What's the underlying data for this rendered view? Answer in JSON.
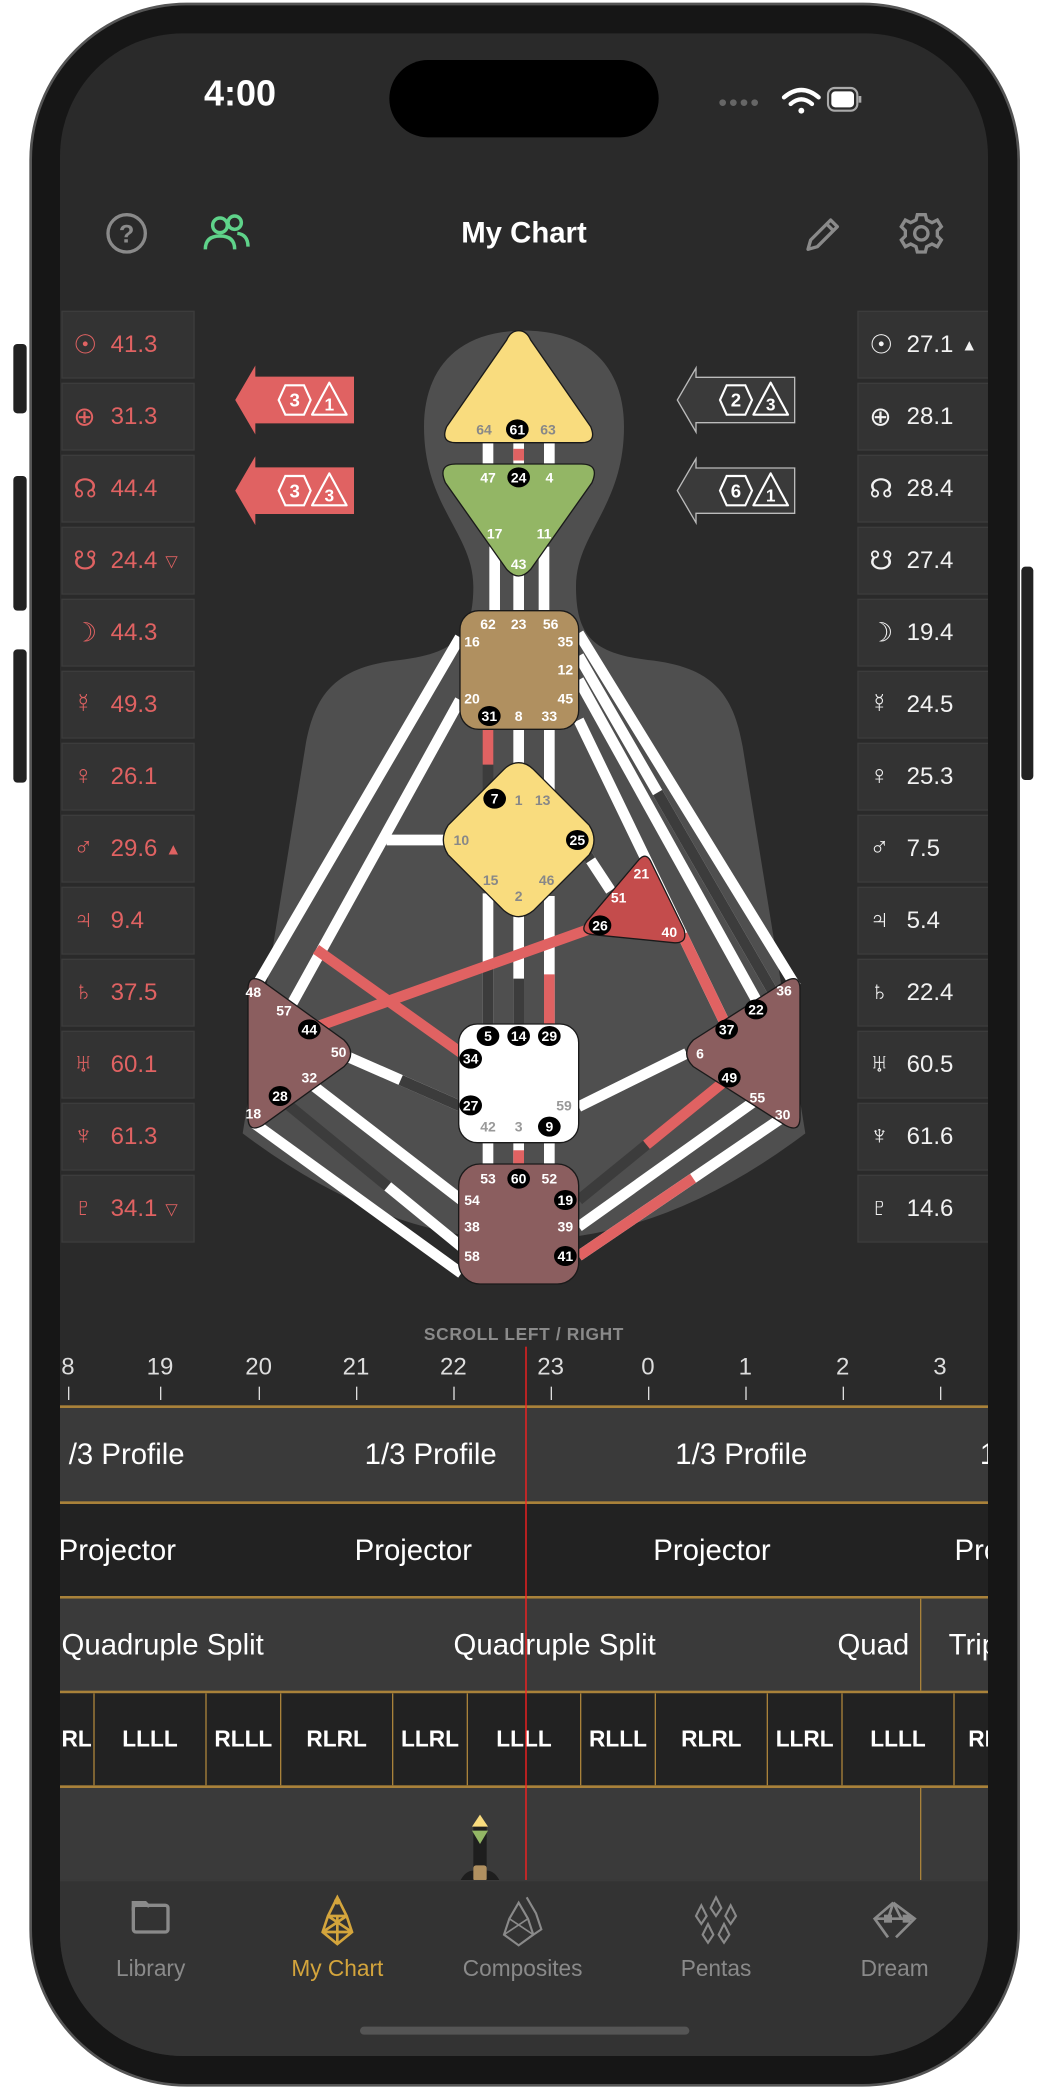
{
  "status_bar": {
    "time": "4:00"
  },
  "header": {
    "title": "My Chart",
    "help_icon": "question-circle-icon",
    "people_icon": "people-icon",
    "edit_icon": "pencil-icon",
    "settings_icon": "gear-icon",
    "people_icon_color": "#5fd38a"
  },
  "design_planets": [
    {
      "symbol": "☉",
      "value": "41.3",
      "arrow": ""
    },
    {
      "symbol": "⊕",
      "value": "31.3",
      "arrow": ""
    },
    {
      "symbol": "☊",
      "value": "44.4",
      "arrow": ""
    },
    {
      "symbol": "☋",
      "value": "24.4",
      "arrow": "▽"
    },
    {
      "symbol": "☽",
      "value": "44.3",
      "arrow": ""
    },
    {
      "symbol": "☿",
      "value": "49.3",
      "arrow": ""
    },
    {
      "symbol": "♀",
      "value": "26.1",
      "arrow": ""
    },
    {
      "symbol": "♂",
      "value": "29.6",
      "arrow": "▲"
    },
    {
      "symbol": "♃",
      "value": "9.4",
      "arrow": ""
    },
    {
      "symbol": "♄",
      "value": "37.5",
      "arrow": ""
    },
    {
      "symbol": "♅",
      "value": "60.1",
      "arrow": ""
    },
    {
      "symbol": "♆",
      "value": "61.3",
      "arrow": ""
    },
    {
      "symbol": "♇",
      "value": "34.1",
      "arrow": "▽"
    }
  ],
  "personality_planets": [
    {
      "symbol": "☉",
      "value": "27.1",
      "arrow": "▲"
    },
    {
      "symbol": "⊕",
      "value": "28.1",
      "arrow": ""
    },
    {
      "symbol": "☊",
      "value": "28.4",
      "arrow": ""
    },
    {
      "symbol": "☋",
      "value": "27.4",
      "arrow": ""
    },
    {
      "symbol": "☽",
      "value": "19.4",
      "arrow": ""
    },
    {
      "symbol": "☿",
      "value": "24.5",
      "arrow": ""
    },
    {
      "symbol": "♀",
      "value": "25.3",
      "arrow": ""
    },
    {
      "symbol": "♂",
      "value": "7.5",
      "arrow": ""
    },
    {
      "symbol": "♃",
      "value": "5.4",
      "arrow": ""
    },
    {
      "symbol": "♄",
      "value": "22.4",
      "arrow": ""
    },
    {
      "symbol": "♅",
      "value": "60.5",
      "arrow": ""
    },
    {
      "symbol": "♆",
      "value": "61.6",
      "arrow": ""
    },
    {
      "symbol": "♇",
      "value": "14.6",
      "arrow": ""
    }
  ],
  "variable_arrows": {
    "design": [
      {
        "hex": "3",
        "tri": "1"
      },
      {
        "hex": "3",
        "tri": "3"
      }
    ],
    "personality": [
      {
        "hex": "2",
        "tri": "3"
      },
      {
        "hex": "6",
        "tri": "1"
      }
    ]
  },
  "colors": {
    "design": "#e06262",
    "personality": "#ffffff",
    "head": "#f9dc7e",
    "ajna": "#93b665",
    "throat": "#b09060",
    "g": "#f9dc7e",
    "ego": "#c44c4c",
    "sacral": "#ffffff",
    "root": "#8b5e5f",
    "spleen": "#8b5e5f",
    "solar_plexus": "#8b5e5f",
    "accent": "#d4a53c",
    "timeline_border": "#a9823a",
    "cursor": "#ff2020"
  },
  "centers": {
    "head": [
      {
        "g": "64",
        "a": false
      },
      {
        "g": "61",
        "a": true
      },
      {
        "g": "63",
        "a": false
      }
    ],
    "ajna": [
      {
        "g": "47",
        "a": false
      },
      {
        "g": "24",
        "a": true
      },
      {
        "g": "4",
        "a": false
      },
      {
        "g": "17",
        "a": false
      },
      {
        "g": "11",
        "a": false
      },
      {
        "g": "43",
        "a": false
      }
    ],
    "throat": [
      {
        "g": "62",
        "a": false
      },
      {
        "g": "23",
        "a": false
      },
      {
        "g": "56",
        "a": false
      },
      {
        "g": "16",
        "a": false
      },
      {
        "g": "35",
        "a": false
      },
      {
        "g": "12",
        "a": false
      },
      {
        "g": "20",
        "a": false
      },
      {
        "g": "45",
        "a": false
      },
      {
        "g": "31",
        "a": true
      },
      {
        "g": "8",
        "a": false
      },
      {
        "g": "33",
        "a": false
      }
    ],
    "g": [
      {
        "g": "1",
        "a": false
      },
      {
        "g": "7",
        "a": true
      },
      {
        "g": "13",
        "a": false
      },
      {
        "g": "10",
        "a": false
      },
      {
        "g": "25",
        "a": true
      },
      {
        "g": "15",
        "a": false
      },
      {
        "g": "46",
        "a": false
      },
      {
        "g": "2",
        "a": false
      }
    ],
    "ego": [
      {
        "g": "21",
        "a": false
      },
      {
        "g": "51",
        "a": false
      },
      {
        "g": "26",
        "a": true
      },
      {
        "g": "40",
        "a": false
      }
    ],
    "sacral": [
      {
        "g": "5",
        "a": true
      },
      {
        "g": "14",
        "a": true
      },
      {
        "g": "29",
        "a": true
      },
      {
        "g": "34",
        "a": true
      },
      {
        "g": "27",
        "a": true
      },
      {
        "g": "59",
        "a": false
      },
      {
        "g": "42",
        "a": false
      },
      {
        "g": "3",
        "a": false
      },
      {
        "g": "9",
        "a": true
      }
    ],
    "root": [
      {
        "g": "53",
        "a": false
      },
      {
        "g": "60",
        "a": true
      },
      {
        "g": "52",
        "a": false
      },
      {
        "g": "54",
        "a": false
      },
      {
        "g": "19",
        "a": true
      },
      {
        "g": "38",
        "a": false
      },
      {
        "g": "39",
        "a": false
      },
      {
        "g": "58",
        "a": false
      },
      {
        "g": "41",
        "a": true
      }
    ],
    "spleen": [
      {
        "g": "48",
        "a": false
      },
      {
        "g": "57",
        "a": false
      },
      {
        "g": "44",
        "a": true
      },
      {
        "g": "50",
        "a": false
      },
      {
        "g": "32",
        "a": false
      },
      {
        "g": "28",
        "a": true
      },
      {
        "g": "18",
        "a": false
      }
    ],
    "solar_plexus": [
      {
        "g": "36",
        "a": false
      },
      {
        "g": "22",
        "a": true
      },
      {
        "g": "37",
        "a": true
      },
      {
        "g": "6",
        "a": false
      },
      {
        "g": "49",
        "a": true
      },
      {
        "g": "55",
        "a": false
      },
      {
        "g": "30",
        "a": false
      }
    ]
  },
  "timeline": {
    "hint": "SCROLL LEFT / RIGHT",
    "hours": [
      "8",
      "19",
      "20",
      "21",
      "22",
      "23",
      "0",
      "1",
      "2",
      "3"
    ],
    "profile_row": [
      "/3 Profile",
      "1/3 Profile",
      "1/3 Profile",
      "1"
    ],
    "type_row": [
      "Projector",
      "Projector",
      "Projector",
      "Pro"
    ],
    "definition_row": [
      "Quadruple Split",
      "Quadruple Split",
      "Quad",
      "Trip"
    ],
    "variables_row": [
      "RL",
      "LLLL",
      "RLLL",
      "RLRL",
      "LLRL",
      "LLLL",
      "RLLL",
      "RLRL",
      "LLRL",
      "LLLL",
      "RL"
    ]
  },
  "tabs": [
    {
      "label": "Library",
      "icon": "folder-icon",
      "active": false
    },
    {
      "label": "My Chart",
      "icon": "bodygraph-icon",
      "active": true
    },
    {
      "label": "Composites",
      "icon": "composite-bodygraph-icon",
      "active": false
    },
    {
      "label": "Pentas",
      "icon": "penta-icon",
      "active": false
    },
    {
      "label": "Dream",
      "icon": "dream-icon",
      "active": false
    }
  ]
}
